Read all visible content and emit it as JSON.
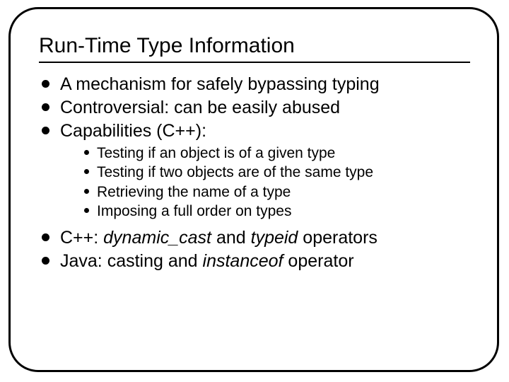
{
  "title": "Run-Time Type Information",
  "bullets": {
    "b0": "A mechanism for safely bypassing typing",
    "b1": "Controversial: can be easily abused",
    "b2": "Capabilities (C++):",
    "sub": {
      "s0": "Testing if an object is of a given type",
      "s1": "Testing if two objects are of the same type",
      "s2": "Retrieving the name of a type",
      "s3": "Imposing a full order on types"
    },
    "b3": {
      "pre": "C++: ",
      "op1": "dynamic_cast",
      "mid": " and ",
      "op2": "typeid",
      "post": " operators"
    },
    "b4": {
      "pre": "Java: casting and ",
      "op": "instanceof",
      "post": " operator"
    }
  }
}
